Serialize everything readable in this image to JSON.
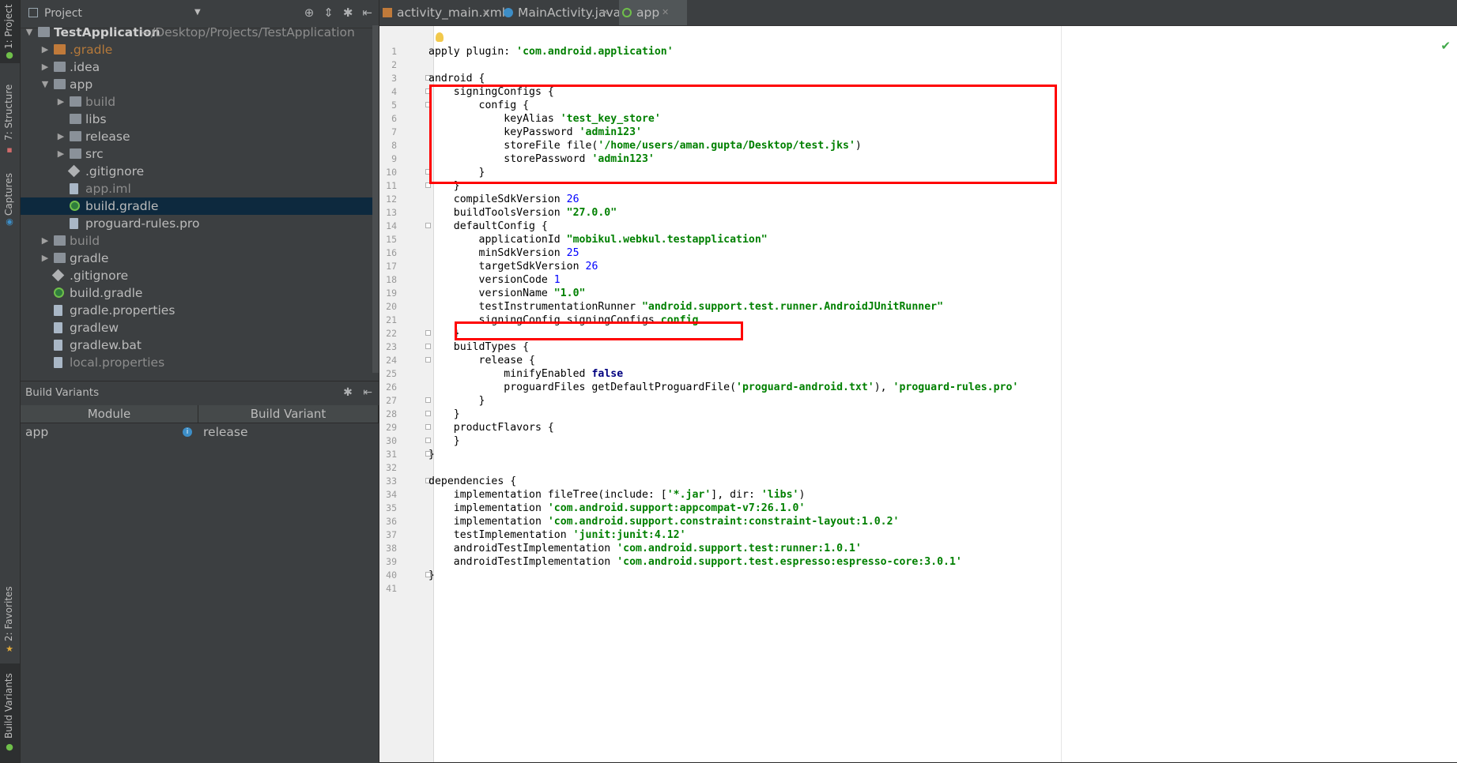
{
  "side_tabs": {
    "project": "1: Project",
    "structure": "7: Structure",
    "captures": "Captures",
    "favorites": "2: Favorites",
    "build_variants": "Build Variants"
  },
  "project_panel": {
    "title": "Project",
    "tree": [
      {
        "label": "TestApplication",
        "sub": "~/Desktop/Projects/TestApplication",
        "depth": 0,
        "type": "folder",
        "arrow": "down"
      },
      {
        "label": ".gradle",
        "depth": 1,
        "type": "folder-orange",
        "arrow": "right",
        "style": "orange"
      },
      {
        "label": ".idea",
        "depth": 1,
        "type": "folder",
        "arrow": "right"
      },
      {
        "label": "app",
        "depth": 1,
        "type": "folder",
        "arrow": "down"
      },
      {
        "label": "build",
        "depth": 2,
        "type": "folder",
        "arrow": "right",
        "style": "dim"
      },
      {
        "label": "libs",
        "depth": 2,
        "type": "folder",
        "arrow": ""
      },
      {
        "label": "release",
        "depth": 2,
        "type": "folder",
        "arrow": "right"
      },
      {
        "label": "src",
        "depth": 2,
        "type": "folder",
        "arrow": "right"
      },
      {
        "label": ".gitignore",
        "depth": 2,
        "type": "git",
        "arrow": ""
      },
      {
        "label": "app.iml",
        "depth": 2,
        "type": "file",
        "arrow": "",
        "style": "dim"
      },
      {
        "label": "build.gradle",
        "depth": 2,
        "type": "gradle",
        "arrow": "",
        "selected": true
      },
      {
        "label": "proguard-rules.pro",
        "depth": 2,
        "type": "file",
        "arrow": ""
      },
      {
        "label": "build",
        "depth": 1,
        "type": "folder",
        "arrow": "right",
        "style": "dim"
      },
      {
        "label": "gradle",
        "depth": 1,
        "type": "folder",
        "arrow": "right"
      },
      {
        "label": ".gitignore",
        "depth": 1,
        "type": "git",
        "arrow": ""
      },
      {
        "label": "build.gradle",
        "depth": 1,
        "type": "gradle",
        "arrow": ""
      },
      {
        "label": "gradle.properties",
        "depth": 1,
        "type": "file",
        "arrow": ""
      },
      {
        "label": "gradlew",
        "depth": 1,
        "type": "file",
        "arrow": ""
      },
      {
        "label": "gradlew.bat",
        "depth": 1,
        "type": "file",
        "arrow": ""
      },
      {
        "label": "local.properties",
        "depth": 1,
        "type": "file",
        "arrow": "",
        "style": "dim"
      }
    ]
  },
  "build_variants": {
    "title": "Build Variants",
    "headers": [
      "Module",
      "Build Variant"
    ],
    "rows": [
      {
        "module": "app",
        "variant": "release"
      }
    ]
  },
  "tabs": [
    {
      "label": "activity_main.xml",
      "icon": "xml-file-icon",
      "active": false
    },
    {
      "label": "MainActivity.java",
      "icon": "java-class-icon",
      "active": false
    },
    {
      "label": "app",
      "icon": "gradle-icon",
      "active": true
    }
  ],
  "code_lines": [
    [
      [
        "apply ",
        ""
      ],
      [
        "plugin",
        ""
      ],
      [
        ": ",
        ""
      ],
      [
        "'com.android.application'",
        "s"
      ]
    ],
    [],
    [
      [
        "android {",
        ""
      ]
    ],
    [
      [
        "    signingConfigs {",
        ""
      ]
    ],
    [
      [
        "        config {",
        ""
      ]
    ],
    [
      [
        "            keyAlias ",
        ""
      ],
      [
        "'test_key_store'",
        "s"
      ]
    ],
    [
      [
        "            keyPassword ",
        ""
      ],
      [
        "'admin123'",
        "s"
      ]
    ],
    [
      [
        "            storeFile file(",
        ""
      ],
      [
        "'/home/users/aman.gupta/Desktop/test.jks'",
        "s"
      ],
      [
        ")",
        ""
      ]
    ],
    [
      [
        "            storePassword ",
        ""
      ],
      [
        "'admin123'",
        "s"
      ]
    ],
    [
      [
        "        }",
        ""
      ]
    ],
    [
      [
        "    }",
        ""
      ]
    ],
    [
      [
        "    compileSdkVersion ",
        ""
      ],
      [
        "26",
        "n"
      ]
    ],
    [
      [
        "    buildToolsVersion ",
        ""
      ],
      [
        "\"27.0.0\"",
        "s"
      ]
    ],
    [
      [
        "    defaultConfig {",
        ""
      ]
    ],
    [
      [
        "        applicationId ",
        ""
      ],
      [
        "\"mobikul.webkul.testapplication\"",
        "s"
      ]
    ],
    [
      [
        "        minSdkVersion ",
        ""
      ],
      [
        "25",
        "n"
      ]
    ],
    [
      [
        "        targetSdkVersion ",
        ""
      ],
      [
        "26",
        "n"
      ]
    ],
    [
      [
        "        versionCode ",
        ""
      ],
      [
        "1",
        "n"
      ]
    ],
    [
      [
        "        versionName ",
        ""
      ],
      [
        "\"1.0\"",
        "s"
      ]
    ],
    [
      [
        "        testInstrumentationRunner ",
        ""
      ],
      [
        "\"android.support.test.runner.AndroidJUnitRunner\"",
        "s"
      ]
    ],
    [
      [
        "        signingConfig signingConfigs.",
        ""
      ],
      [
        "config",
        "s"
      ]
    ],
    [
      [
        "    }",
        ""
      ]
    ],
    [
      [
        "    buildTypes {",
        ""
      ]
    ],
    [
      [
        "        release {",
        ""
      ]
    ],
    [
      [
        "            minifyEnabled ",
        ""
      ],
      [
        "false",
        "k"
      ]
    ],
    [
      [
        "            proguardFiles getDefaultProguardFile(",
        ""
      ],
      [
        "'proguard-android.txt'",
        "s"
      ],
      [
        "), ",
        ""
      ],
      [
        "'proguard-rules.pro'",
        "s"
      ]
    ],
    [
      [
        "        }",
        ""
      ]
    ],
    [
      [
        "    }",
        ""
      ]
    ],
    [
      [
        "    productFlavors {",
        ""
      ]
    ],
    [
      [
        "    }",
        ""
      ]
    ],
    [
      [
        "}",
        ""
      ]
    ],
    [],
    [
      [
        "dependencies {",
        ""
      ]
    ],
    [
      [
        "    implementation fileTree(",
        ""
      ],
      [
        "include",
        ""
      ],
      [
        ": [",
        ""
      ],
      [
        "'*.jar'",
        "s"
      ],
      [
        "], ",
        ""
      ],
      [
        "dir",
        ""
      ],
      [
        ": ",
        ""
      ],
      [
        "'libs'",
        "s"
      ],
      [
        ")",
        ""
      ]
    ],
    [
      [
        "    implementation ",
        ""
      ],
      [
        "'com.android.support:appcompat-v7:26.1.0'",
        "s"
      ]
    ],
    [
      [
        "    implementation ",
        ""
      ],
      [
        "'com.android.support.constraint:constraint-layout:1.0.2'",
        "s"
      ]
    ],
    [
      [
        "    testImplementation ",
        ""
      ],
      [
        "'junit:junit:4.12'",
        "s"
      ]
    ],
    [
      [
        "    androidTestImplementation ",
        ""
      ],
      [
        "'com.android.support.test:runner:1.0.1'",
        "s"
      ]
    ],
    [
      [
        "    androidTestImplementation ",
        ""
      ],
      [
        "'com.android.support.test.espresso:espresso-core:3.0.1'",
        "s"
      ]
    ],
    [
      [
        "}",
        ""
      ]
    ],
    []
  ],
  "colors": {
    "highlight": "#ff0000",
    "string": "#008000",
    "number": "#0000ff",
    "keyword": "#000080"
  }
}
